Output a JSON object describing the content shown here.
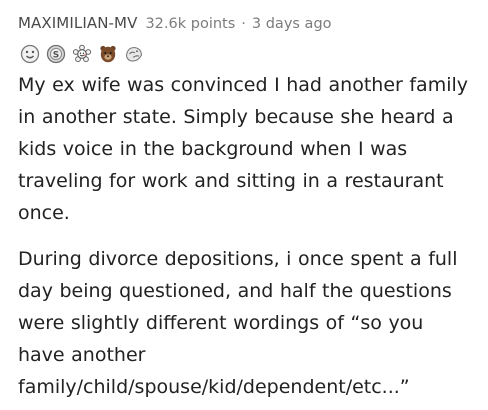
{
  "comment": {
    "author": "MAXIMILIAN-MV",
    "points": "32.6k points",
    "separator": "·",
    "age": "3 days ago",
    "awards": [
      "helpful-award-icon",
      "silver-award-icon",
      "wholesome-award-icon",
      "bear-award-icon",
      "hug-award-icon"
    ],
    "paragraphs": [
      "My ex wife was convinced I had another family in another state. Simply because she heard a kids voice in the background when I was traveling for work and sitting in a restaurant once.",
      "During divorce depositions, i once spent a full day being questioned, and half the questions were slightly different wordings of “so you have another family/child/spouse/kid/dependent/etc...”"
    ]
  }
}
